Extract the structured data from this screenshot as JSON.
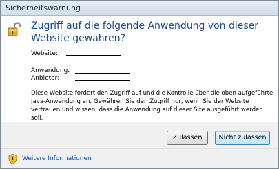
{
  "window": {
    "title": "Sicherheitswarnung"
  },
  "main": {
    "heading": "Zugriff auf die folgende Anwendung von dieser Website gewähren?",
    "fields": {
      "website_label": "Website:",
      "website_value": "",
      "application_label": "Anwendung.",
      "application_value": "",
      "provider_label": "Anbieter:",
      "provider_value": ""
    },
    "description": "Diese Website fordert den Zugriff auf und die Kontrolle über die oben aufgeführte Java-Anwendung an. Gewähren Sie den Zugriff nur, wenn Sie der Website vertrauen und wissen, dass die Anwendung auf dieser Site ausgeführt werden soll."
  },
  "buttons": {
    "allow_label": "Zulassen",
    "deny_label": "Nicht zulassen"
  },
  "footer": {
    "more_info_label": "Weitere Informationen"
  },
  "icons": {
    "warning": "unlocked-padlock-icon",
    "info": "shield-warning-icon"
  }
}
